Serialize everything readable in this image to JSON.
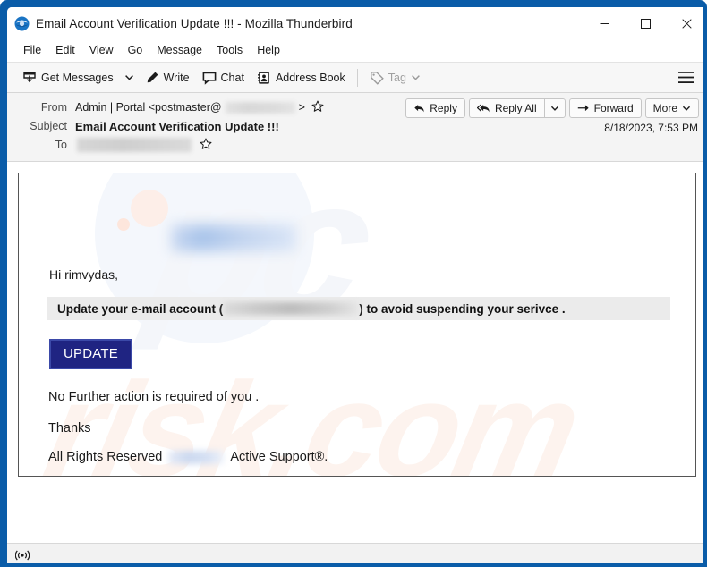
{
  "window": {
    "title": "Email Account Verification Update !!! - Mozilla Thunderbird",
    "app_icon": "thunderbird-icon",
    "controls": {
      "minimize": "minimize-icon",
      "maximize": "maximize-icon",
      "close": "close-icon"
    },
    "frame_color": "#0a5ca8"
  },
  "menubar": {
    "items": [
      {
        "label": "File",
        "accel": "F"
      },
      {
        "label": "Edit",
        "accel": "E"
      },
      {
        "label": "View",
        "accel": "V"
      },
      {
        "label": "Go",
        "accel": "G"
      },
      {
        "label": "Message",
        "accel": "M"
      },
      {
        "label": "Tools",
        "accel": "T"
      },
      {
        "label": "Help",
        "accel": "H"
      }
    ]
  },
  "toolbar": {
    "get_messages": "Get Messages",
    "write": "Write",
    "chat": "Chat",
    "address_book": "Address Book",
    "tag": "Tag",
    "app_menu": "app-menu-icon"
  },
  "message_header": {
    "from_label": "From",
    "from_value": "Admin | Portal <postmaster@",
    "from_value_end": ">",
    "subject_label": "Subject",
    "subject_value": "Email Account Verification Update !!!",
    "to_label": "To",
    "to_value": "",
    "date": "8/18/2023, 7:53 PM",
    "actions": {
      "reply": "Reply",
      "reply_all": "Reply All",
      "forward": "Forward",
      "more": "More"
    }
  },
  "email_body": {
    "greeting": "Hi rimvydas,",
    "highlight_prefix": "Update your  e-mail account (",
    "highlight_suffix": ") to avoid suspending your serivce  .",
    "cta_button": "UPDATE",
    "line_no_action": "No Further action is required of you .",
    "line_thanks": "Thanks",
    "footer_prefix": "All Rights Reserved",
    "footer_suffix": "Active Support®.",
    "cta_color": "#1f2482",
    "highlight_bg": "#ebebeb",
    "watermark_top": "pc",
    "watermark_bottom": "risk.com"
  },
  "statusbar": {
    "icon": "online-status-icon",
    "text": ""
  }
}
